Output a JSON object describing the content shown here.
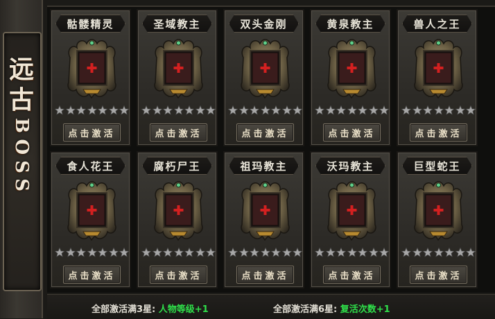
{
  "side_title": {
    "cn": [
      "远",
      "古"
    ],
    "en": "BOSS"
  },
  "cards": [
    {
      "name": "骷髅精灵",
      "button": "点击激活",
      "stars_filled": 0,
      "stars_total": 7
    },
    {
      "name": "圣域教主",
      "button": "点击激活",
      "stars_filled": 0,
      "stars_total": 7
    },
    {
      "name": "双头金刚",
      "button": "点击激活",
      "stars_filled": 0,
      "stars_total": 7
    },
    {
      "name": "黄泉教主",
      "button": "点击激活",
      "stars_filled": 0,
      "stars_total": 7
    },
    {
      "name": "兽人之王",
      "button": "点击激活",
      "stars_filled": 0,
      "stars_total": 7
    },
    {
      "name": "食人花王",
      "button": "点击激活",
      "stars_filled": 0,
      "stars_total": 7
    },
    {
      "name": "腐朽尸王",
      "button": "点击激活",
      "stars_filled": 0,
      "stars_total": 7
    },
    {
      "name": "祖玛教主",
      "button": "点击激活",
      "stars_filled": 0,
      "stars_total": 7
    },
    {
      "name": "沃玛教主",
      "button": "点击激活",
      "stars_filled": 0,
      "stars_total": 7
    },
    {
      "name": "巨型蛇王",
      "button": "点击激活",
      "stars_filled": 0,
      "stars_total": 7
    }
  ],
  "footer": {
    "reward1_label": "全部激活满3星:",
    "reward1_value": "人物等级+1",
    "reward2_label": "全部激活满6星:",
    "reward2_value": "复活次数+1"
  },
  "colors": {
    "bonus_text": "#2fe04a",
    "add_cross": "#c81c1c",
    "star_empty": "#9a9a9a"
  }
}
